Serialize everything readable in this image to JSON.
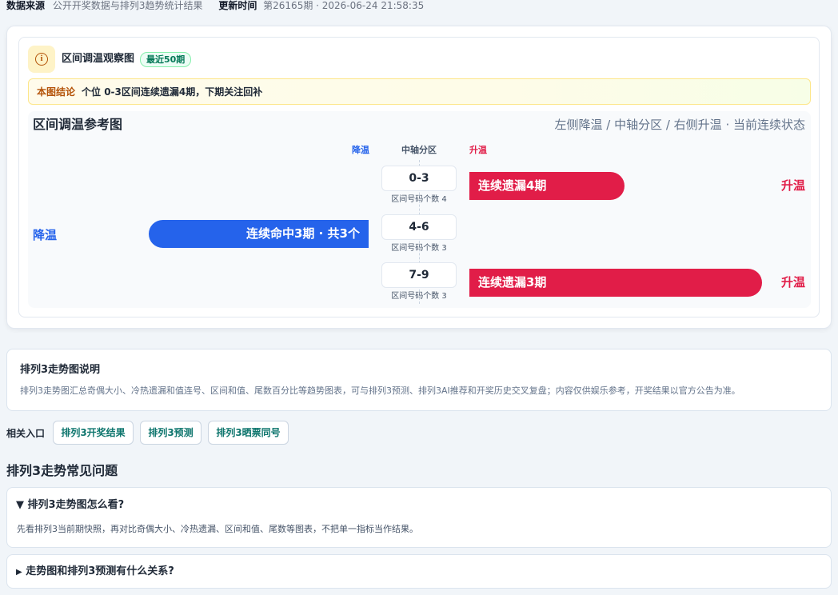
{
  "meta": {
    "source_label": "数据来源",
    "source_value": "公开开奖数据与排列3趋势统计结果",
    "update_label": "更新时间",
    "update_value": "第26165期 · 2026-06-24 21:58:35"
  },
  "observe": {
    "title": "区间调温观察图",
    "badge": "最近50期",
    "conclusion_label": "本图结论",
    "conclusion_text": "个位 0-3区间连续遗漏4期，下期关注回补"
  },
  "chart_data": {
    "type": "bar",
    "title": "区间调温参考图",
    "subtitle": "左侧降温 / 中轴分区 / 右侧升温 · 当前连续状态",
    "left_header": "降温",
    "center_header": "中轴分区",
    "right_header": "升温",
    "colors": {
      "cool": "#2563eb",
      "warm": "#e11d48"
    },
    "rows": [
      {
        "zone": "0-3",
        "count_label": "区间号码个数 4",
        "direction": "升温",
        "label": "连续遗漏4期",
        "streak": 4
      },
      {
        "zone": "4-6",
        "count_label": "区间号码个数 3",
        "direction": "降温",
        "label": "连续命中3期 · 共3个",
        "streak": 3
      },
      {
        "zone": "7-9",
        "count_label": "区间号码个数 3",
        "direction": "升温",
        "label": "连续遗漏3期",
        "streak": 3
      }
    ]
  },
  "explain": {
    "title": "排列3走势图说明",
    "body": "排列3走势图汇总奇偶大小、冷热遗漏和值连号、区间和值、尾数百分比等趋势图表，可与排列3预测、排列3AI推荐和开奖历史交叉复盘；内容仅供娱乐参考，开奖结果以官方公告为准。"
  },
  "related": {
    "label": "相关入口",
    "links": [
      "排列3开奖结果",
      "排列3预测",
      "排列3晒票同号"
    ]
  },
  "faq": {
    "heading": "排列3走势常见问题",
    "items": [
      {
        "marker": "▼",
        "q": "排列3走势图怎么看?",
        "a": "先看排列3当前期快照，再对比奇偶大小、冷热遗漏、区间和值、尾数等图表，不把单一指标当作结果。"
      },
      {
        "marker": "▶",
        "q": "走势图和排列3预测有什么关系?"
      }
    ]
  }
}
